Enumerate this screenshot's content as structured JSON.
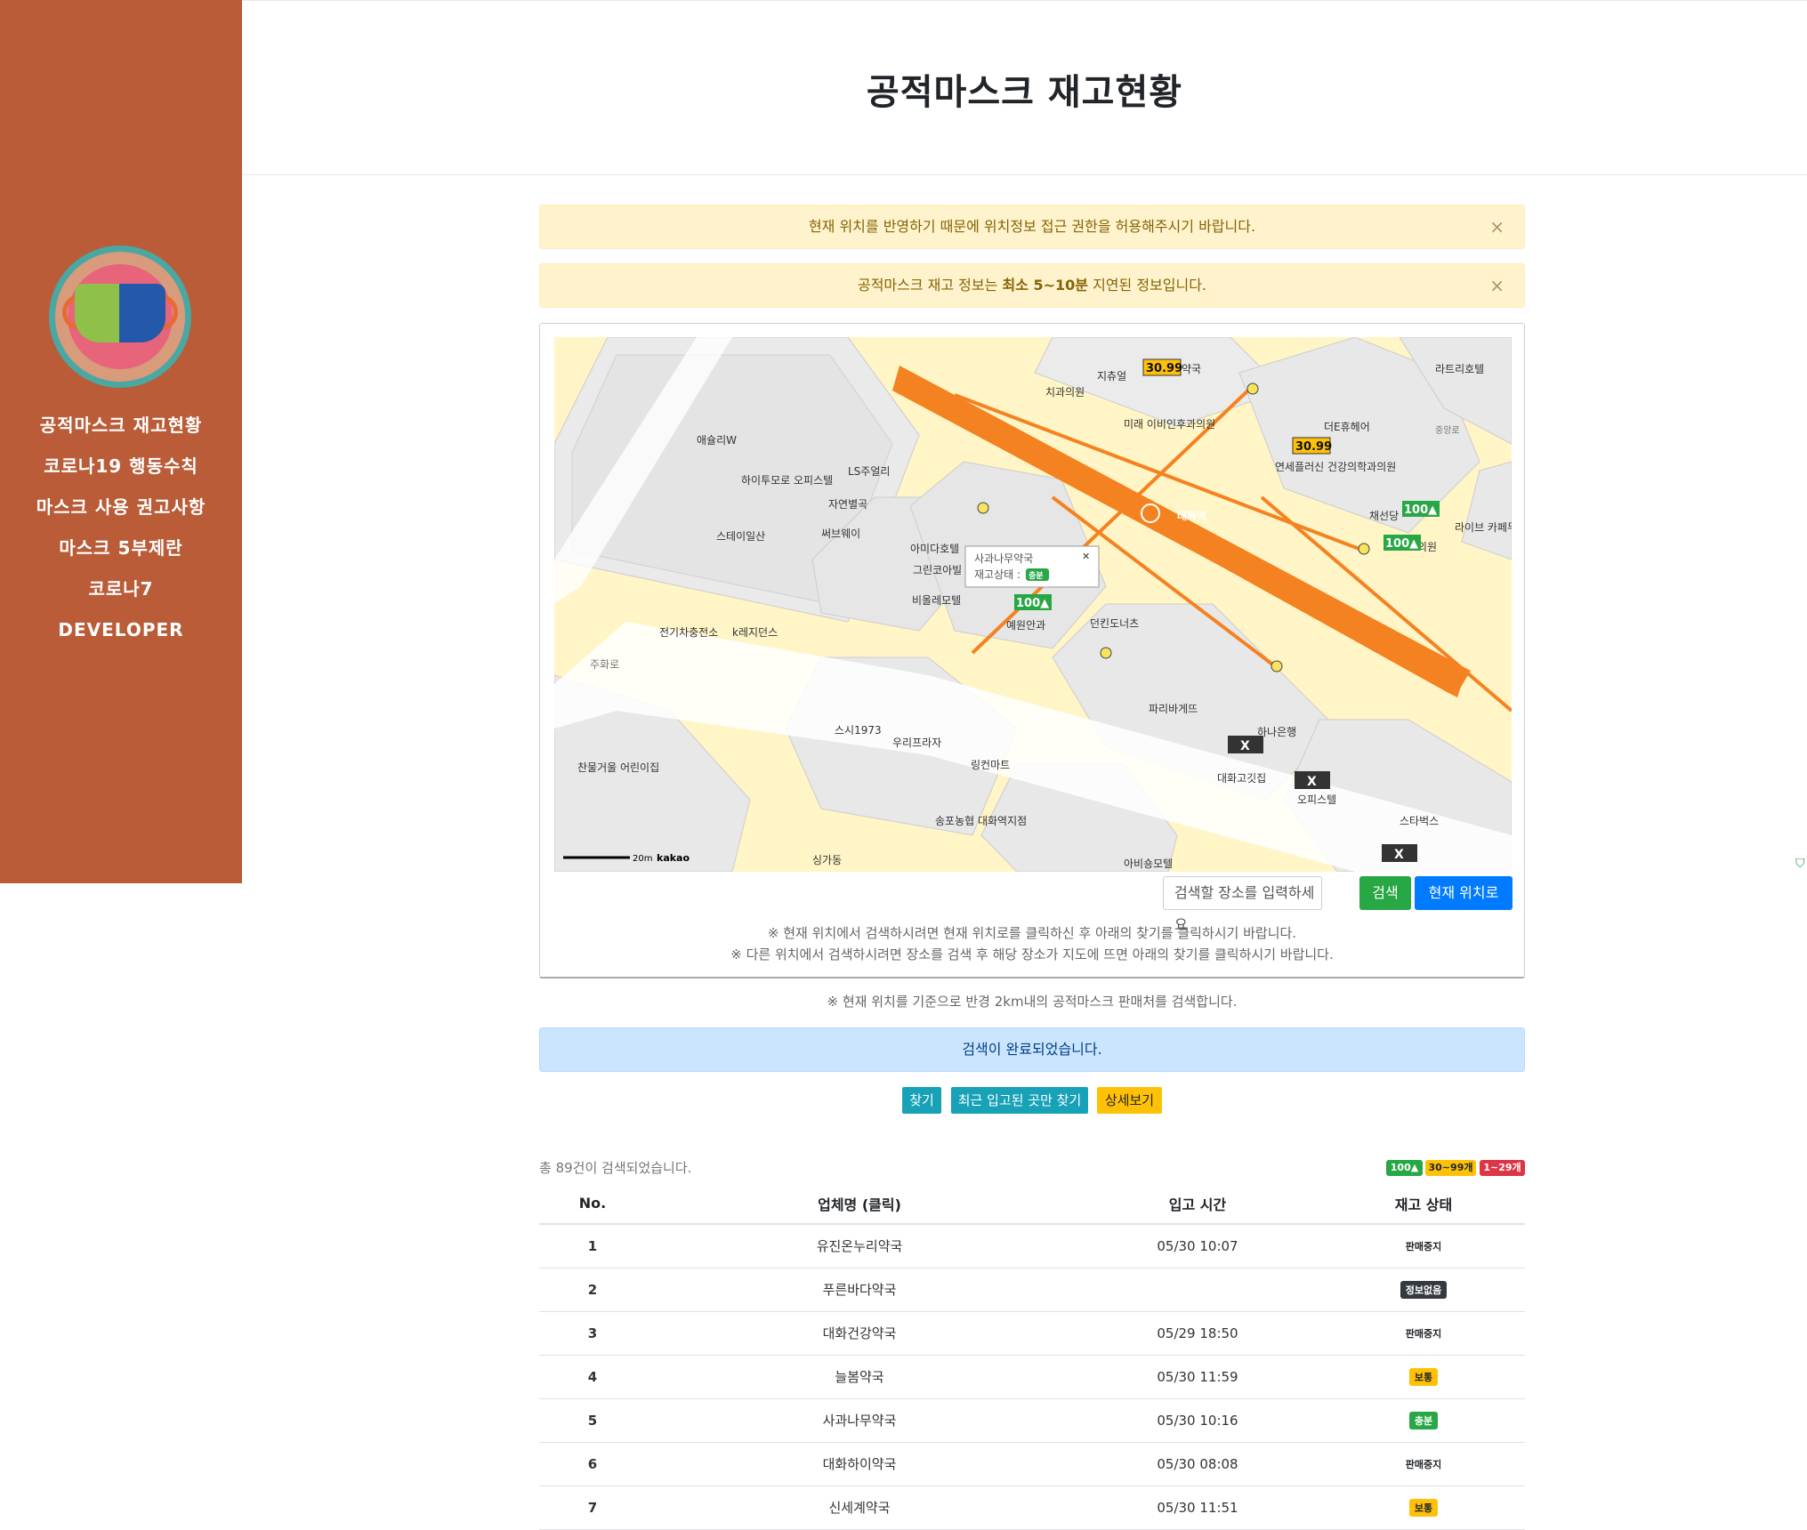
{
  "sidebar": {
    "logo_label": "마스크 로고",
    "nav": [
      {
        "label": "공적마스크 재고현황"
      },
      {
        "label": "코로나19 행동수칙"
      },
      {
        "label": "마스크 사용 권고사항"
      },
      {
        "label": "마스크 5부제란"
      },
      {
        "label": "코로나7"
      },
      {
        "label": "DEVELOPER"
      }
    ]
  },
  "header": {
    "title": "공적마스크 재고현황"
  },
  "alerts": {
    "location": "현재 위치를 반영하기 때문에 위치정보 접근 권한을 허용해주시기 바랍니다.",
    "delay_prefix": "공적마스크 재고 정보는 ",
    "delay_bold": "최소 5~10분",
    "delay_suffix": " 지연된 정보입니다.",
    "close": "×"
  },
  "map": {
    "popup_name": "사과나무약국",
    "popup_status_label": "재고상태 :",
    "popup_status_badge": "충분",
    "place_labels": {
      "p1": "애슐리W",
      "p2": "하이투모로 오피스텔",
      "p3": "LS주얼리",
      "p4": "자연별곡",
      "p5": "써브웨이",
      "p6": "스테이일산",
      "p7": "전기차충전소",
      "p8": "k레지던스",
      "p9": "아미다호텔",
      "p10": "그린코아빌",
      "p11": "비올레모텔",
      "p12": "예원안과",
      "p13": "던킨도너츠",
      "p14": "파리바게뜨",
      "p15": "하나은행",
      "p16": "대화고깃집",
      "p17": "오피스텔",
      "p18": "스타벅스",
      "p19": "스시1973",
      "p20": "우리프라자",
      "p21": "링컨마트",
      "p22": "송포농협 대화역지점",
      "p23": "싱가동",
      "p24": "아비숑모텔",
      "p25": "찬물거울 어린이집",
      "p26": "치과의원",
      "p27": "지츄얼",
      "p28": "미래 이비인후과의원",
      "p29": "더E휴헤어",
      "p30": "연세플러신 건강의학과의원",
      "p31": "채선당",
      "p32": "라이브 카페무아",
      "p33": "라트리호텔",
      "p34": "주화로",
      "p35": "대화역",
      "p36": "약국",
      "p37": "의원",
      "p38": "중앙로"
    },
    "markers": {
      "m1": "30.99",
      "m2": "30.99",
      "m3": "100▲",
      "m4": "100▲",
      "m5": "100▲",
      "x": "X"
    },
    "scale_label": "20m",
    "brand": "kakao"
  },
  "search": {
    "placeholder": "검색할 장소를 입력하세요",
    "search_btn": "검색",
    "current_btn": "현재 위치로"
  },
  "hints": {
    "h1": "※ 현재 위치에서 검색하시려면 현재 위치로를 클릭하신 후 아래의 찾기를 클릭하시기 바랍니다.",
    "h2": "※ 다른 위치에서 검색하시려면 장소를 검색 후 해당 장소가 지도에 뜨면 아래의 찾기를 클릭하시기 바랍니다."
  },
  "note": "※ 현재 위치를 기준으로 반경 2km내의 공적마스크 판매처를 검색합니다.",
  "info": "검색이 완료되었습니다.",
  "buttons": {
    "find": "찾기",
    "recent": "최근 입고된 곳만 찾기",
    "detail": "상세보기"
  },
  "total": "총 89건이 검색되었습니다.",
  "legend": {
    "plenty": "100▲",
    "some": "30~99개",
    "few": "1~29개"
  },
  "colors": {
    "plenty": "#28a745",
    "some": "#ffc107",
    "few": "#dc3545",
    "sidebar": "#b95c37",
    "info": "#17a2b8"
  },
  "table": {
    "headers": [
      "No.",
      "업체명 (클릭)",
      "입고 시간",
      "재고 상태"
    ],
    "rows": [
      {
        "no": "1",
        "name": "유진온누리약국",
        "time": "05/30 10:07",
        "status": "판매중지"
      },
      {
        "no": "2",
        "name": "푸른바다약국",
        "time": "",
        "status": "정보없음"
      },
      {
        "no": "3",
        "name": "대화건강약국",
        "time": "05/29 18:50",
        "status": "판매중지"
      },
      {
        "no": "4",
        "name": "늘봄약국",
        "time": "05/30 11:59",
        "status": "보통"
      },
      {
        "no": "5",
        "name": "사과나무약국",
        "time": "05/30 10:16",
        "status": "충분"
      },
      {
        "no": "6",
        "name": "대화하이약국",
        "time": "05/30 08:08",
        "status": "판매중지"
      },
      {
        "no": "7",
        "name": "신세계약국",
        "time": "05/30 11:51",
        "status": "보통"
      }
    ]
  }
}
